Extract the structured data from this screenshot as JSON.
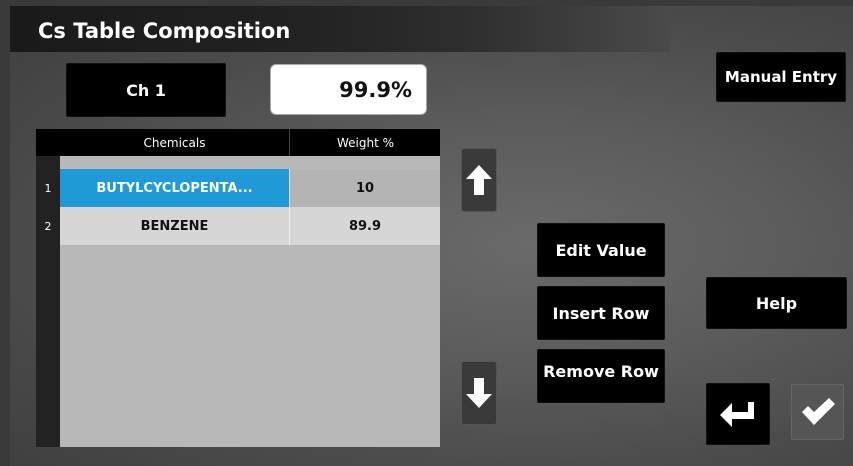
{
  "header": {
    "title": "Cs Table Composition"
  },
  "channel": {
    "label": "Ch 1",
    "value": "99.9%"
  },
  "table": {
    "columns": [
      "Chemicals",
      "Weight %"
    ],
    "rows": [
      {
        "index": "1",
        "chemical": "BUTYLCYCLOPENTA...",
        "weight": "10",
        "selected": true
      },
      {
        "index": "2",
        "chemical": "BENZENE",
        "weight": "89.9",
        "selected": false
      }
    ]
  },
  "buttons": {
    "manual_entry": "Manual Entry",
    "edit_value": "Edit Value",
    "insert_row": "Insert Row",
    "remove_row": "Remove Row",
    "help": "Help"
  },
  "icons": {
    "up": "arrow-up-icon",
    "down": "arrow-down-icon",
    "back": "return-arrow-icon",
    "confirm": "checkmark-icon"
  },
  "colors": {
    "selected_row": "#1f9ad6",
    "header_bg": "#000000",
    "button_bg": "#000000"
  }
}
